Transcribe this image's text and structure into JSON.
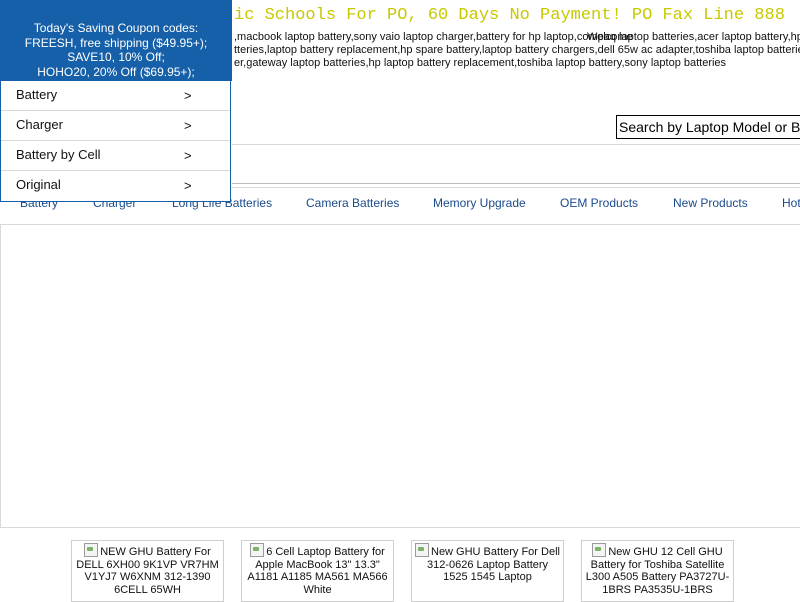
{
  "coupon": {
    "title": "Today's Saving Coupon codes:",
    "lines": [
      "FREESH, free shipping ($49.95+);",
      "SAVE10, 10% Off;",
      "HOHO20, 20% Off ($69.95+);"
    ]
  },
  "menu": {
    "items": [
      {
        "label": "Battery",
        "chevron": ">"
      },
      {
        "label": "Charger",
        "chevron": ">"
      },
      {
        "label": "Battery by Cell",
        "chevron": ">"
      },
      {
        "label": "Original",
        "chevron": ">"
      }
    ]
  },
  "banner": {
    "text": "ic Schools For PO, 60 Days No Payment! PO Fax Line 888"
  },
  "keywords": {
    "line1": ",macbook laptop battery,sony vaio laptop charger,battery for hp laptop,compaq laptop batteries,acer laptop battery,hp spare",
    "line2": "tteries,laptop battery replacement,hp spare battery,laptop battery chargers,dell 65w ac adapter,toshiba laptop batteries",
    "line3": "er,gateway laptop batteries,hp laptop battery replacement,toshiba laptop battery,sony laptop batteries",
    "welcome": "Welcome"
  },
  "search": {
    "placeholder": "Search by Laptop Model or Battery"
  },
  "nav": {
    "items": [
      "Battery",
      "Charger",
      "Long Life Batteries",
      "Camera Batteries",
      "Memory Upgrade",
      "OEM Products",
      "New Products",
      "Hot"
    ]
  },
  "products": [
    {
      "title": "NEW GHU Battery For DELL 6XH00 9K1VP VR7HM V1YJ7 W6XNM 312-1390 6CELL 65WH"
    },
    {
      "title": "6 Cell Laptop Battery for Apple MacBook 13\" 13.3\" A1181 A1185 MA561 MA566 White"
    },
    {
      "title": "New GHU Battery For Dell 312-0626 Laptop Battery 1525 1545 Laptop"
    },
    {
      "title": "New GHU 12 Cell GHU Battery for Toshiba Satellite L300 A505 Battery PA3727U-1BRS PA3535U-1BRS"
    }
  ]
}
